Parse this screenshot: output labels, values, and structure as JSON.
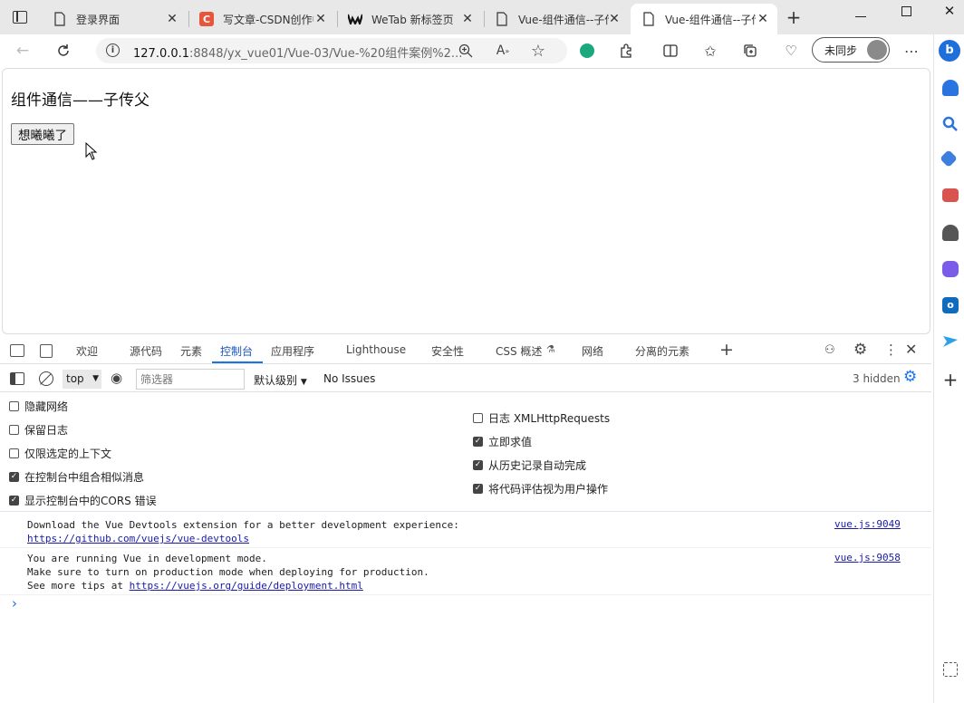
{
  "tabs": [
    {
      "title": "登录界面",
      "favicon": "page-icon"
    },
    {
      "title": "写文章-CSDN创作中心",
      "favicon": "csdn-icon"
    },
    {
      "title": "WeTab 新标签页",
      "favicon": "wetab-icon"
    },
    {
      "title": "Vue-组件通信--子传父",
      "favicon": "page-icon"
    },
    {
      "title": "Vue-组件通信--子传父",
      "favicon": "page-icon",
      "active": true
    }
  ],
  "address": {
    "url_host": "127.0.0.1",
    "url_rest": ":8848/yx_vue01/Vue-03/Vue-%20组件案例%2..."
  },
  "profile": {
    "sync_label": "未同步"
  },
  "page": {
    "title": "组件通信——子传父",
    "button_label": "想曦曦了"
  },
  "devtools": {
    "tabs": [
      "欢迎",
      "源代码",
      "元素",
      "控制台",
      "应用程序",
      "Lighthouse",
      "安全性",
      "CSS 概述",
      "网络",
      "分离的元素"
    ],
    "active_tab": "控制台",
    "context": "top",
    "filter_placeholder": "筛选器",
    "level": "默认级别",
    "issues": "No Issues",
    "hidden": "3 hidden",
    "settings_left": [
      {
        "label": "隐藏网络",
        "checked": false
      },
      {
        "label": "保留日志",
        "checked": false
      },
      {
        "label": "仅限选定的上下文",
        "checked": false
      },
      {
        "label": "在控制台中组合相似消息",
        "checked": true
      },
      {
        "label": "显示控制台中的CORS 错误",
        "checked": true
      }
    ],
    "settings_right": [
      {
        "label": "日志 XMLHttpRequests",
        "checked": false
      },
      {
        "label": "立即求值",
        "checked": true
      },
      {
        "label": "从历史记录自动完成",
        "checked": true
      },
      {
        "label": "将代码评估视为用户操作",
        "checked": true
      }
    ],
    "messages": [
      {
        "lines": [
          "Download the Vue Devtools extension for a better development experience:"
        ],
        "link": "https://github.com/vuejs/vue-devtools",
        "source": "vue.js:9049"
      },
      {
        "lines": [
          "You are running Vue in development mode.",
          "Make sure to turn on production mode when deploying for production."
        ],
        "link_prefix": "See more tips at ",
        "link": "https://vuejs.org/guide/deployment.html",
        "source": "vue.js:9058"
      }
    ],
    "prompt": "›"
  },
  "colors": {
    "accent": "#1a73e8",
    "csdn": "#e8553a",
    "tabstrip": "#e8e8e8"
  }
}
